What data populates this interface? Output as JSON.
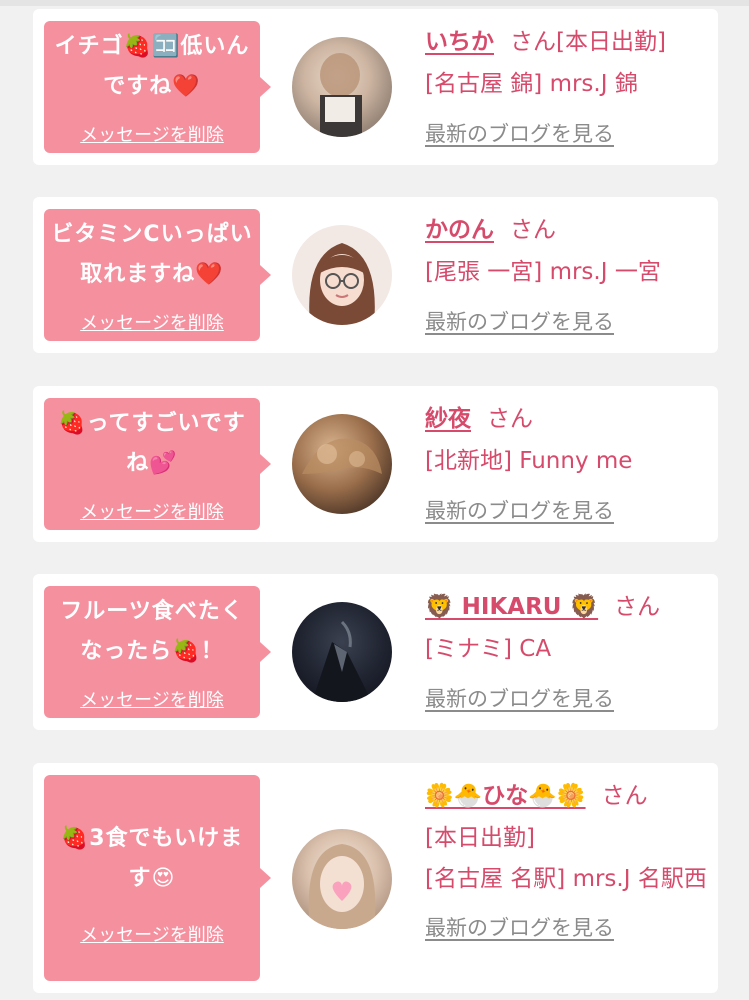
{
  "cards": [
    {
      "message": "イチゴ🍓🈁低いんですね❤️",
      "delete_label": "メッセージを削除",
      "name": "いちか",
      "suffix": "さん[本日出勤]",
      "area": "[名古屋 錦] mrs.J 錦",
      "blog_link": "最新のブログを見る"
    },
    {
      "message": "ビタミンCいっぱい取れますね❤️",
      "delete_label": "メッセージを削除",
      "name": "かのん",
      "suffix": "さん",
      "area": "[尾張 一宮] mrs.J 一宮",
      "blog_link": "最新のブログを見る"
    },
    {
      "message": "🍓ってすごいですね💕",
      "delete_label": "メッセージを削除",
      "name": "紗夜",
      "suffix": "さん",
      "area": "[北新地] Funny me",
      "blog_link": "最新のブログを見る"
    },
    {
      "message": "フルーツ食べたくなったら🍓！",
      "delete_label": "メッセージを削除",
      "name": "🦁 HIKARU 🦁",
      "suffix": "さん",
      "area": "[ミナミ] CA",
      "blog_link": "最新のブログを見る"
    },
    {
      "message": "🍓3食でもいけます😍",
      "delete_label": "メッセージを削除",
      "name": "🌼🐣ひな🐣🌼",
      "suffix": "さん",
      "status": "[本日出勤]",
      "area": "[名古屋 名駅] mrs.J 名駅西",
      "blog_link": "最新のブログを見る"
    }
  ],
  "colors": {
    "page_bg": "#f1f1f1",
    "bubble": "#f5909f",
    "name": "#d64b6c",
    "blog_link": "#8b8b8b"
  }
}
